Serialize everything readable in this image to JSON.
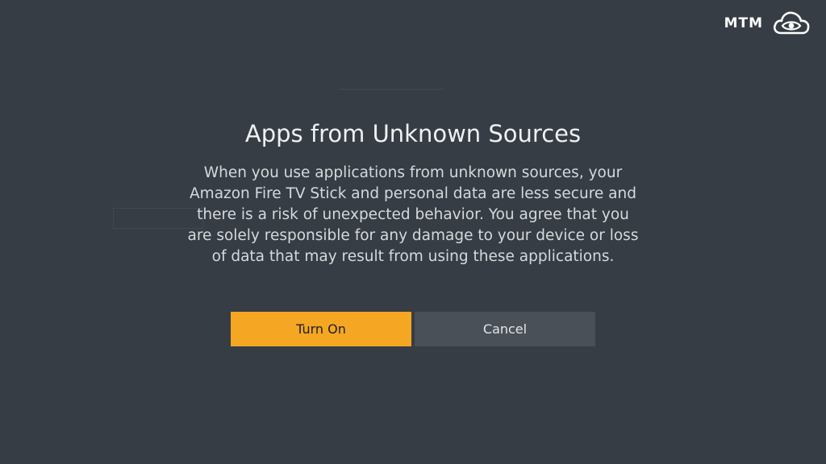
{
  "watermark": {
    "text": "MTM",
    "icon": "cloud-eye-icon"
  },
  "dialog": {
    "title": "Apps from Unknown Sources",
    "body": "When you use applications from unknown sources, your Amazon Fire TV Stick and personal data are less secure and there is a risk of unexpected behavior. You agree that you are solely responsible for any damage to your device or loss of data that may result from using these applications.",
    "buttons": {
      "confirm_label": "Turn On",
      "cancel_label": "Cancel"
    }
  },
  "colors": {
    "background": "#363d44",
    "primary_button": "#f5a623",
    "secondary_button": "#4a5058"
  }
}
